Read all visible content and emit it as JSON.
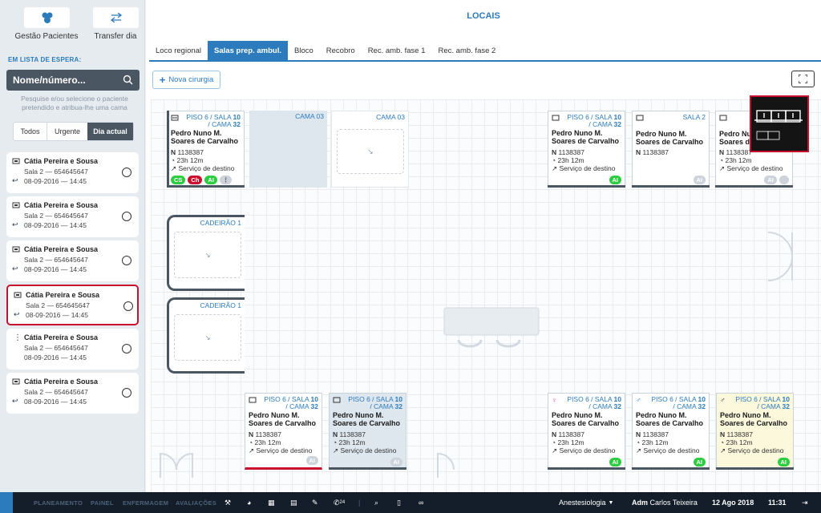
{
  "sidebar": {
    "gestao_label": "Gestão Pacientes",
    "transfer_label": "Transfer dia",
    "waitlist_label": "EM LISTA DE ESPERA:",
    "search_placeholder": "Nome/número...",
    "hint": "Pesquise e/ou selecione o paciente pretendido e atribua-lhe uma cama",
    "filters": [
      "Todos",
      "Urgente",
      "Dia actual"
    ],
    "patients": [
      {
        "name": "Cátia Pereira e Sousa",
        "room": "Sala 2 — 654645647",
        "date": "08-09-2016 — 14:45",
        "icon": "bed-icon"
      },
      {
        "name": "Cátia Pereira e Sousa",
        "room": "Sala 2 — 654645647",
        "date": "08-09-2016 — 14:45",
        "icon": "bed-icon"
      },
      {
        "name": "Cátia Pereira e Sousa",
        "room": "Sala 2 — 654645647",
        "date": "08-09-2016 — 14:45",
        "icon": "bed-icon"
      },
      {
        "name": "Cátia Pereira e Sousa",
        "room": "Sala 2 — 654645647",
        "date": "08-09-2016 — 14:45",
        "icon": "bed-icon"
      },
      {
        "name": "Cátia Pereira e Sousa",
        "room": "Sala 2 — 654645647",
        "date": "08-09-2016 — 14:45",
        "icon": "more-icon"
      },
      {
        "name": "Cátia Pereira e Sousa",
        "room": "Sala 2 — 654645647",
        "date": "08-09-2016 — 14:45",
        "icon": "bed-icon"
      }
    ]
  },
  "main": {
    "title": "LOCAIS",
    "tabs": [
      "Loco regional",
      "Salas prep. ambul.",
      "Bloco",
      "Recobro",
      "Rec. amb. fase 1",
      "Rec. amb. fase 2"
    ],
    "new_surgery": "Nova cirurgia"
  },
  "beds": {
    "loc_prefix": "PISO 6 / SALA ",
    "loc_sala": "10",
    "loc_mid": " / CAMA ",
    "loc_cama": "32",
    "patient": "Pedro Nuno M. Soares de Carvalho",
    "n_label": "N",
    "number": "1138387",
    "time": "23h 12m",
    "dest": "Serviço de destino",
    "pill_ai": "AI",
    "pill_cs": "CS",
    "pill_ch": "Ch",
    "cama03": "CAMA 03",
    "sala2": "SALA 2",
    "cadeirao": "CADEIRÃO 1",
    "piso_trunc": "PISO 6"
  },
  "bottom": {
    "nav": [
      "PLANEAMENTO",
      "PAINEL",
      "ENFERMAGEM",
      "AVALIAÇÕES"
    ],
    "dept": "Anestesiologia",
    "user_role": "Adm",
    "user_name": "Carlos Teixeira",
    "date": "12 Ago 2018",
    "time": "11:31",
    "phone_badge": "24"
  },
  "colors": {
    "accent": "#2b7bbd",
    "alert": "#c8102e",
    "ok": "#2ecc40",
    "dark": "#4b5663"
  }
}
